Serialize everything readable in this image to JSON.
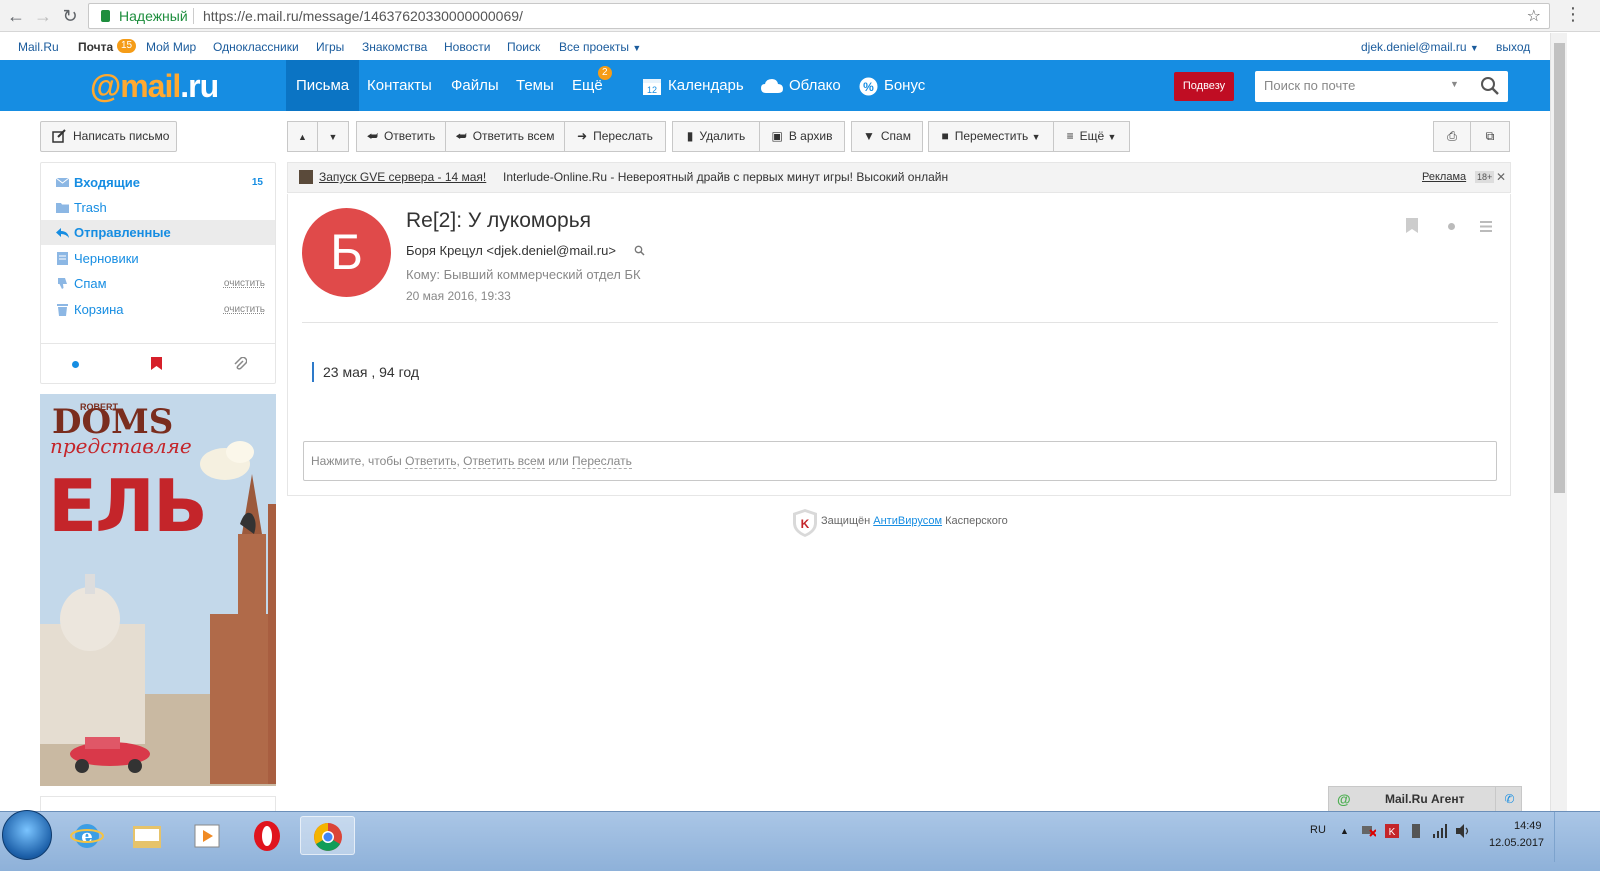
{
  "browser": {
    "secure_label": "Надежный",
    "url": "https://e.mail.ru/message/14637620330000000069/"
  },
  "portal": {
    "links": [
      "Mail.Ru",
      "Почта",
      "Мой Мир",
      "Одноклассники",
      "Игры",
      "Знакомства",
      "Новости",
      "Поиск",
      "Все проекты"
    ],
    "pochta_count": "15",
    "user_email": "djek.deniel@mail.ru",
    "logout": "выход"
  },
  "header": {
    "logo_at": "@",
    "logo_mail": "mail",
    "logo_ru": ".ru",
    "nav": [
      "Письма",
      "Контакты",
      "Файлы",
      "Темы",
      "Ещё"
    ],
    "esche_badge": "2",
    "calendar": "Календарь",
    "calendar_day": "12",
    "cloud": "Облако",
    "bonus": "Бонус",
    "promo_button": "Подвезу",
    "search_placeholder": "Поиск по почте",
    "accent_color": "#168de2"
  },
  "sidebar": {
    "compose": "Написать письмо",
    "folders": [
      {
        "label": "Входящие",
        "count": "15"
      },
      {
        "label": "Trash"
      },
      {
        "label": "Отправленные"
      },
      {
        "label": "Черновики"
      },
      {
        "label": "Спам",
        "action": "очистить"
      },
      {
        "label": "Корзина",
        "action": "очистить"
      }
    ]
  },
  "ad": {
    "brand_top": "ROBERT",
    "brand": "DOMS",
    "line1": "представляе",
    "line2": "ЕЛЬ"
  },
  "toolbar": {
    "reply": "Ответить",
    "reply_all": "Ответить всем",
    "forward": "Переслать",
    "delete": "Удалить",
    "archive": "В архив",
    "spam": "Спам",
    "move": "Переместить",
    "more": "Ещё"
  },
  "adline": {
    "link": "Запуск GVE сервера - 14 мая!",
    "text": "Interlude-Online.Ru - Невероятный драйв с первых минут игры! Высокий онлайн",
    "reklama": "Реклама",
    "age": "18+"
  },
  "message": {
    "avatar_letter": "Б",
    "subject": "Re[2]: У лукоморья",
    "from": "Боря Крецул <djek.deniel@mail.ru>",
    "to": "Кому: Бывший коммерческий отдел БК",
    "date": "20 мая 2016, 19:33",
    "quote": "23 мая , 94 год",
    "reply_prefix": "Нажмите, чтобы",
    "reply_link": "Ответить",
    "reply_all_link": "Ответить всем",
    "reply_or": "или",
    "forward_link": "Переслать"
  },
  "kaspersky": {
    "prefix": "Защищён",
    "link": "АнтиВирус",
    "link_suffix": "ом",
    "suffix": "Касперского"
  },
  "agent": {
    "title": "Mail.Ru Агент"
  },
  "taskbar": {
    "lang": "RU",
    "time": "14:49",
    "date": "12.05.2017"
  }
}
